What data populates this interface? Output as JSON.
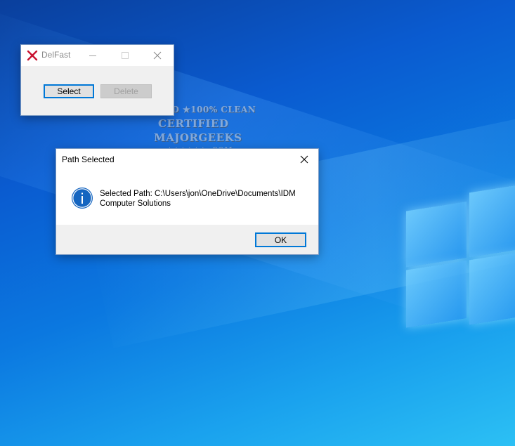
{
  "desktop": {
    "watermark": {
      "line1": "TESTED ★100% CLEAN",
      "line2": "CERTIFIED",
      "line3": "MAJORGEEKS",
      "line4": "★★★★★★ .COM"
    }
  },
  "delfast_window": {
    "title": "DelFast",
    "select_label": "Select",
    "delete_label": "Delete"
  },
  "dialog": {
    "title": "Path Selected",
    "message_line1": "Selected Path: C:\\Users\\jon\\OneDrive\\Documents\\IDM",
    "message_line2": "Computer Solutions",
    "ok_label": "OK"
  },
  "colors": {
    "accent": "#0078d7",
    "info_icon": "#1565c0"
  }
}
